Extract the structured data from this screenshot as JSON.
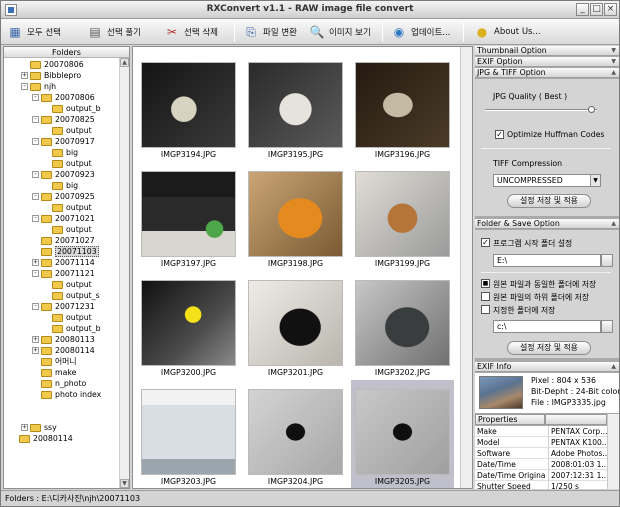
{
  "window": {
    "title": "RXConvert v1.1 - RAW image file convert",
    "controls": [
      "minimize-icon",
      "maximize-icon",
      "close-icon"
    ]
  },
  "toolbar": {
    "buttons": [
      {
        "label": "모두 선택",
        "icon": "select-all-icon"
      },
      {
        "label": "선택 풀기",
        "icon": "deselect-icon"
      },
      {
        "label": "선택 삭제",
        "icon": "scissors-icon"
      },
      {
        "label": "파일 변환",
        "icon": "convert-icon"
      },
      {
        "label": "이미지 보기",
        "icon": "view-image-icon"
      },
      {
        "label": "업데이트...",
        "icon": "update-globe-icon"
      },
      {
        "label": "About Us...",
        "icon": "about-icon"
      }
    ]
  },
  "folders": {
    "header": "Folders",
    "nodes": [
      {
        "label": "20070806",
        "expander": ""
      },
      {
        "label": "Bibblepro",
        "expander": "+"
      },
      {
        "label": "njh",
        "expander": "-"
      },
      {
        "label": "20070806",
        "expander": "-"
      },
      {
        "label": "output_b",
        "expander": ""
      },
      {
        "label": "20070825",
        "expander": "-"
      },
      {
        "label": "output",
        "expander": ""
      },
      {
        "label": "20070917",
        "expander": "-"
      },
      {
        "label": "big",
        "expander": ""
      },
      {
        "label": "output",
        "expander": ""
      },
      {
        "label": "20070923",
        "expander": "-"
      },
      {
        "label": "big",
        "expander": ""
      },
      {
        "label": "20070925",
        "expander": "-"
      },
      {
        "label": "output",
        "expander": ""
      },
      {
        "label": "20071021",
        "expander": "-"
      },
      {
        "label": "output",
        "expander": ""
      },
      {
        "label": "20071027",
        "expander": ""
      },
      {
        "label": "20071103",
        "expander": ""
      },
      {
        "label": "20071114",
        "expander": "+"
      },
      {
        "label": "20071121",
        "expander": "-"
      },
      {
        "label": "output",
        "expander": ""
      },
      {
        "label": "output_s",
        "expander": ""
      },
      {
        "label": "20071231",
        "expander": "-"
      },
      {
        "label": "output",
        "expander": ""
      },
      {
        "label": "output_b",
        "expander": ""
      },
      {
        "label": "20080113",
        "expander": "+"
      },
      {
        "label": "20080114",
        "expander": "+"
      },
      {
        "label": "어머니",
        "expander": ""
      },
      {
        "label": "make",
        "expander": ""
      },
      {
        "label": "n_photo",
        "expander": ""
      },
      {
        "label": "photo index",
        "expander": ""
      },
      {
        "label": "ssy",
        "expander": "+"
      },
      {
        "label": "20080114",
        "expander": ""
      }
    ]
  },
  "thumbnails": [
    {
      "name": "IMGP3194.JPG",
      "scene": "box-dark"
    },
    {
      "name": "IMGP3195.JPG",
      "scene": "box-light"
    },
    {
      "name": "IMGP3196.JPG",
      "scene": "box-brown"
    },
    {
      "name": "IMGP3197.JPG",
      "scene": "drive-green"
    },
    {
      "name": "IMGP3198.JPG",
      "scene": "drive-orange"
    },
    {
      "name": "IMGP3199.JPG",
      "scene": "drive-mixed"
    },
    {
      "name": "IMGP3200.JPG",
      "scene": "disc-yellow"
    },
    {
      "name": "IMGP3201.JPG",
      "scene": "drive-black"
    },
    {
      "name": "IMGP3202.JPG",
      "scene": "drive-grey"
    },
    {
      "name": "IMGP3203.JPG",
      "scene": "freeagent-box"
    },
    {
      "name": "IMGP3204.JPG",
      "scene": "cable"
    },
    {
      "name": "IMGP3205.JPG",
      "scene": "cable-selected"
    }
  ],
  "options": {
    "thumbnail_header": "Thumbnail Option",
    "exif_header": "EXIF Option",
    "jpg_header": "JPG & TIFF Option",
    "jpg_quality_label": "JPG Quality ( Best )",
    "jpg_quality_value": 0.95,
    "optimize_label": "Optimize Huffman Codes",
    "optimize_checked": true,
    "tiff_label": "TIFF Compression",
    "tiff_value": "UNCOMPRESSED",
    "apply_label_1": "설정 저장 및 적용",
    "folder_header": "Folder & Save Option",
    "startup_folder_label": "프로그램 시작 폴더 설정",
    "startup_checked": true,
    "startup_path": "E:\\",
    "radio_same": "원본 파일과 동일한 폴더에 저장",
    "radio_sub": "원본 파일의 하위 폴더에 저장",
    "check_specified": "지정한 폴더에 저장",
    "specified_path": "c:\\",
    "apply_label_2": "설정 저장 및 적용"
  },
  "exif": {
    "header": "EXIF Info",
    "pixel": "Pixel : 804 x 536",
    "bitdepth": "Bit-Depht : 24-Bit color",
    "file": "File : IMGP3335.jpg",
    "properties_header": "Properties",
    "rows": [
      {
        "k": "Make",
        "v": "PENTAX Corp..."
      },
      {
        "k": "Model",
        "v": "PENTAX K100..."
      },
      {
        "k": "Software",
        "v": "Adobe Photos..."
      },
      {
        "k": "Date/Time",
        "v": "2008:01:03 1..."
      },
      {
        "k": "Date/Time Original",
        "v": "2007:12:31 1..."
      },
      {
        "k": "Shutter Speed",
        "v": "1/250 s"
      }
    ]
  },
  "status": {
    "text": "Folders : E:\\디카사진\\njh\\20071103"
  },
  "colors": {
    "selection": "#bfc0cc",
    "folder": "#f0c84a",
    "panel": "#d4d4d4"
  }
}
